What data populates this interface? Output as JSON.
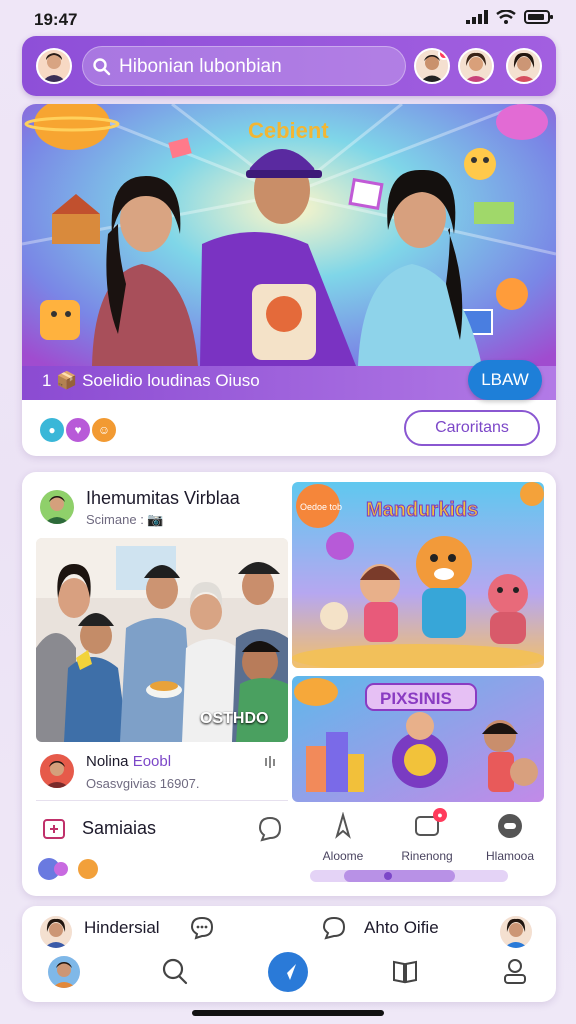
{
  "status": {
    "time": "19:47"
  },
  "topbar": {
    "search_text": "Hibonian lubonbian"
  },
  "feature": {
    "banner_text": "1 📦 Soelidio loudinas Oiuso",
    "poster_text": "Cebient",
    "action_label": "LBAW",
    "secondary_label": "Caroritans",
    "colors": {
      "accent": "#8e4fd8",
      "button": "#1e7fd8"
    }
  },
  "post": {
    "author": "Ihemumitas Virblaa",
    "meta": "Scimane : 📷",
    "photo_caption": "OSTHDO",
    "thumb1_title": "Mandurkids",
    "thumb1_badge": "Oedoe tob",
    "thumb2_title": "PIXSINIS",
    "comment": {
      "name": "Nolina",
      "name_accent": "Eoobl",
      "meta": "Osasvgivias 16907."
    },
    "secondary_label": "Samiaias",
    "actions": [
      {
        "icon": "chat-bubble-icon",
        "label": ""
      },
      {
        "icon": "navigation-icon",
        "label": "Aloome"
      },
      {
        "icon": "notification-box-icon",
        "label": "Rinenong"
      },
      {
        "icon": "record-icon",
        "label": "Hlamooa"
      }
    ],
    "progress": 0.25
  },
  "bottom": {
    "left_label": "Hindersial",
    "right_label": "Ahto Oifie"
  }
}
